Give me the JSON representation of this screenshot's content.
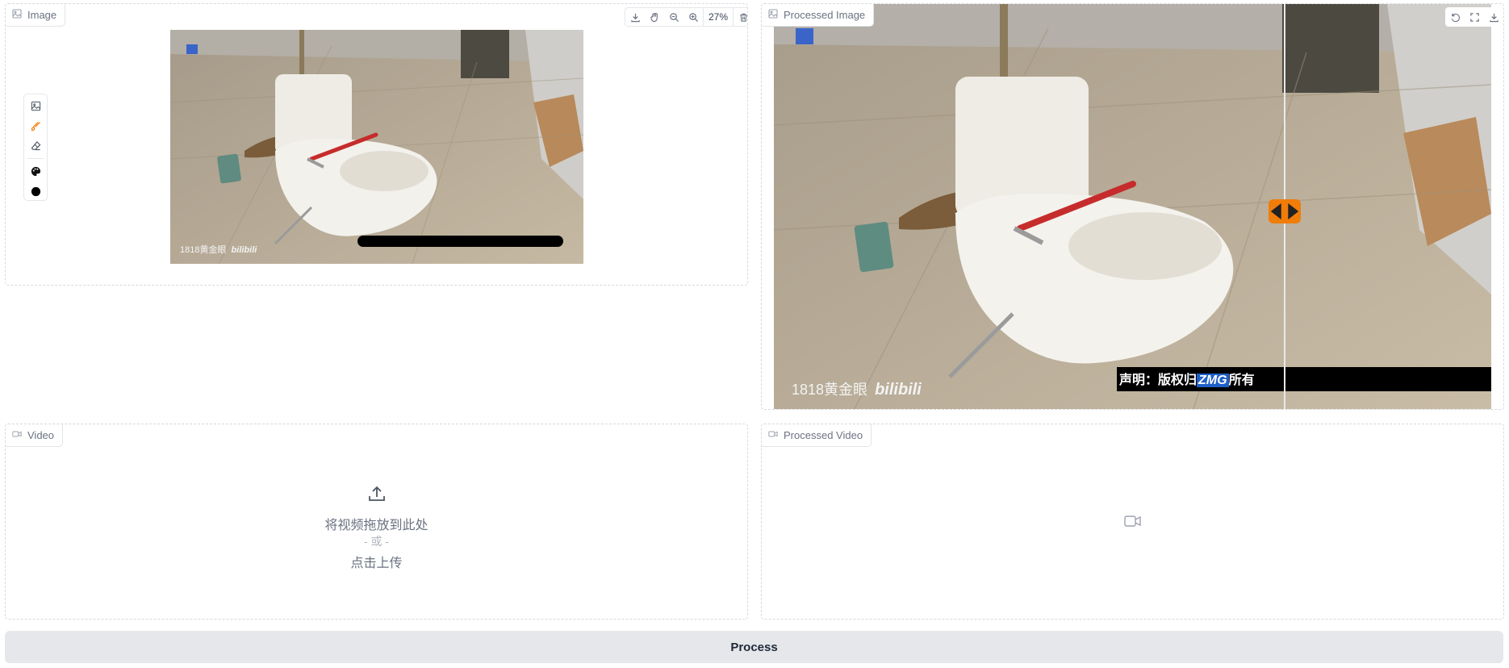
{
  "image_panel": {
    "label": "Image",
    "zoom": "27%",
    "watermark": "1818黄金眼",
    "watermark_brand": "bilibili"
  },
  "processed_image_panel": {
    "label": "Processed Image",
    "watermark": "1818黄金眼",
    "watermark_brand": "bilibili",
    "caption_prefix": "声明：版权归",
    "caption_brand": "ZMG",
    "caption_suffix": "所有"
  },
  "video_panel": {
    "label": "Video",
    "drop_text": "将视频拖放到此处",
    "or_text": "- 或 -",
    "click_text": "点击上传"
  },
  "processed_video_panel": {
    "label": "Processed Video"
  },
  "process_button": {
    "label": "Process"
  },
  "colors": {
    "accent": "#f07c0a",
    "button_bg": "#e5e7eb",
    "border": "#d6d9de"
  },
  "icons": [
    "image-icon",
    "download-icon",
    "pan-icon",
    "zoom-out-icon",
    "zoom-in-icon",
    "trash-icon",
    "brush-icon",
    "eraser-icon",
    "palette-icon",
    "color-dot-icon",
    "undo-icon",
    "fullscreen-icon",
    "video-icon",
    "upload-icon",
    "slider-handle-icon"
  ]
}
